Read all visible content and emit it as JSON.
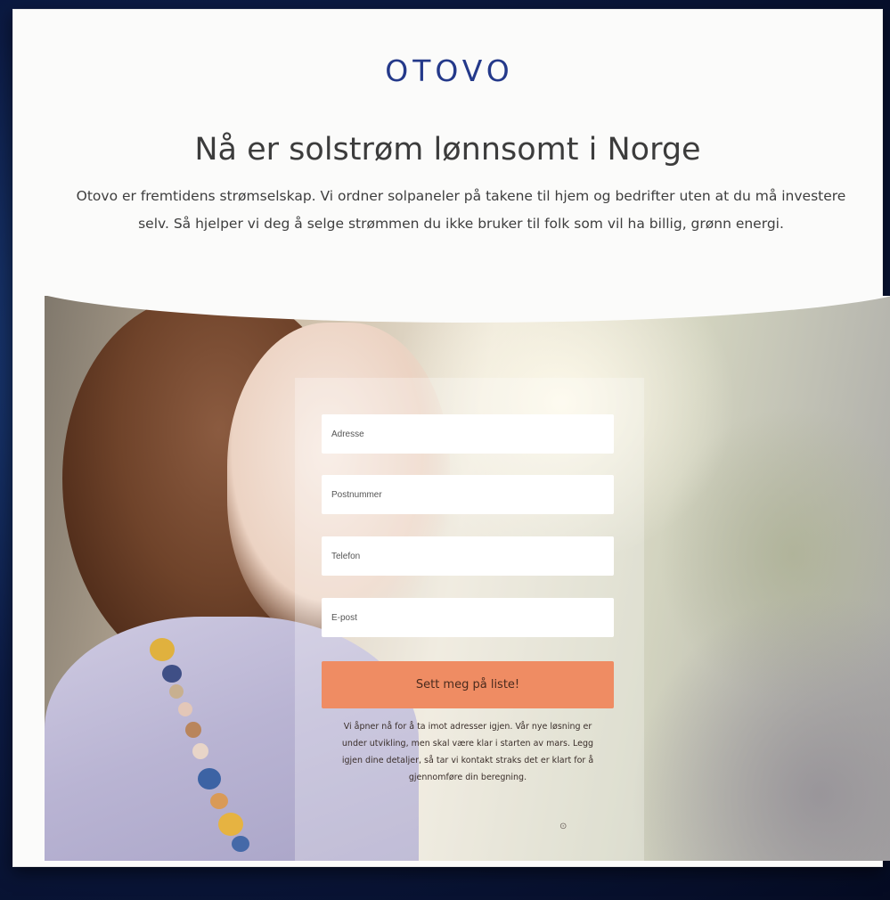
{
  "brand": {
    "logo_text": "OTOVO",
    "accent_color": "#f0906b",
    "logo_color": "#24398a"
  },
  "header": {
    "title": "Nå er solstrøm lønnsomt i Norge",
    "intro": "Otovo er fremtidens strømselskap. Vi ordner solpaneler på takene til hjem og bedrifter uten at du må investere selv. Så hjelper vi deg å selge strømmen du ikke bruker til folk som vil ha billig, grønn energi."
  },
  "form": {
    "address_placeholder": "Adresse",
    "postcode_placeholder": "Postnummer",
    "phone_placeholder": "Telefon",
    "email_placeholder": "E-post",
    "submit_label": "Sett meg på liste!",
    "submit_color": "#ef8c63",
    "fineprint": "Vi åpner nå for å ta imot adresser igjen. Vår nye løsning er under utvikling, men skal være klar i starten av mars. Legg igjen dine detaljer, så tar vi kontakt straks det er klart for å gjennomføre din beregning."
  }
}
